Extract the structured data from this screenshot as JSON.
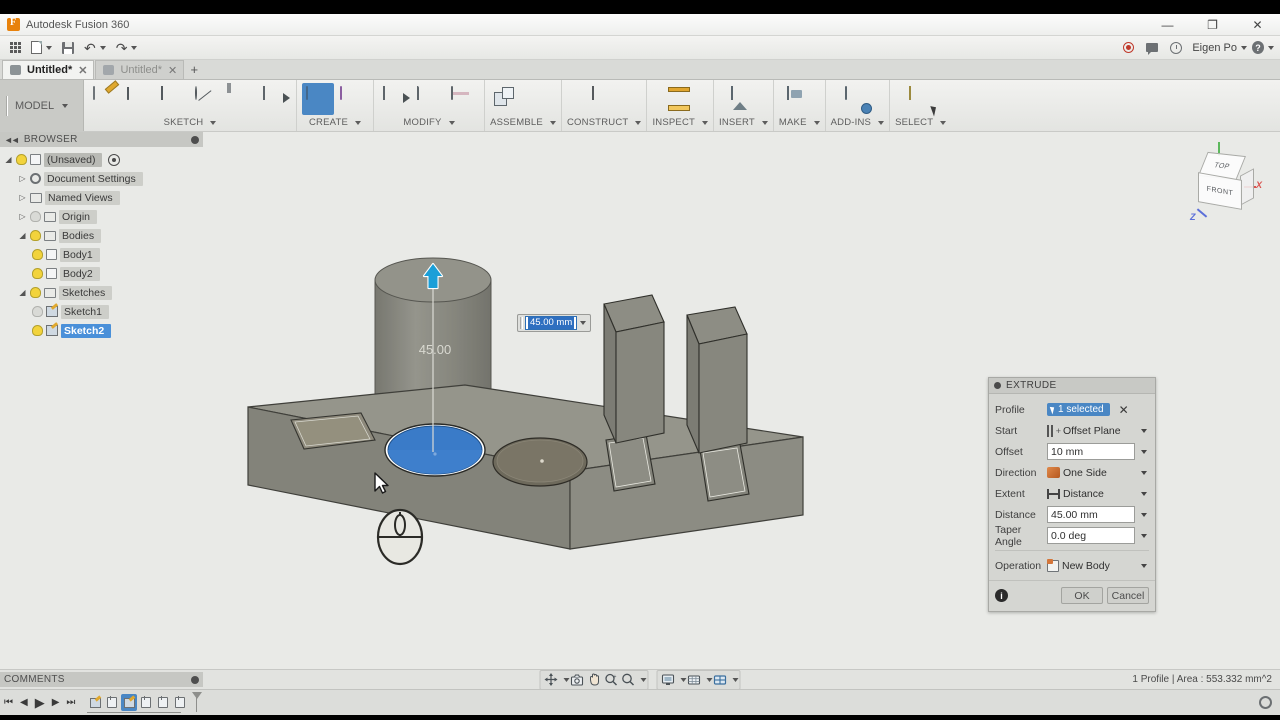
{
  "window": {
    "title": "Autodesk Fusion 360",
    "minimize": "—",
    "maximize": "❐",
    "close": "✕"
  },
  "quick_access": {
    "items": [
      {
        "name": "app-grid",
        "icon": "grid-icon",
        "label": ""
      },
      {
        "name": "file",
        "icon": "document-icon",
        "label": ""
      },
      {
        "name": "save",
        "icon": "save-icon",
        "label": ""
      },
      {
        "name": "undo",
        "icon": "undo-icon",
        "label": "↶"
      },
      {
        "name": "redo",
        "icon": "redo-icon",
        "label": "↷"
      }
    ],
    "right": {
      "record_icon": "record-icon",
      "chat_icon": "chat-icon",
      "clock_icon": "clock-icon",
      "user_name": "Eigen Po",
      "help_icon": "help-icon",
      "help_glyph": "?"
    }
  },
  "tabs": [
    {
      "label": "Untitled*",
      "active": true,
      "close": "✕"
    },
    {
      "label": "Untitled*",
      "active": false,
      "close": "✕"
    }
  ],
  "new_tab_label": "+",
  "ribbon": {
    "workspace": "MODEL",
    "groups": [
      {
        "label": "SKETCH",
        "buttons": [
          {
            "name": "create-sketch-button",
            "icon": "create-sketch-icon"
          },
          {
            "name": "line-button",
            "icon": "line-arc-icon"
          },
          {
            "name": "rectangle-button",
            "icon": "rectangle-icon"
          },
          {
            "name": "circle-button",
            "icon": "circle-icon"
          },
          {
            "name": "dimension-button",
            "icon": "sketch-dimension-icon"
          },
          {
            "name": "sketch-extras-button",
            "icon": "sketch-palette-icon"
          }
        ]
      },
      {
        "label": "CREATE",
        "buttons": [
          {
            "name": "extrude-button",
            "icon": "extrude-icon",
            "selected": true
          },
          {
            "name": "revolve-button",
            "icon": "revolve-icon"
          }
        ]
      },
      {
        "label": "MODIFY",
        "buttons": [
          {
            "name": "press-pull-button",
            "icon": "press-pull-icon"
          },
          {
            "name": "fillet-button",
            "icon": "fillet-icon"
          },
          {
            "name": "shell-button",
            "icon": "shell-icon"
          }
        ]
      },
      {
        "label": "ASSEMBLE",
        "buttons": [
          {
            "name": "new-component-button",
            "icon": "new-component-icon"
          },
          {
            "name": "joint-button",
            "icon": "joint-icon"
          }
        ]
      },
      {
        "label": "CONSTRUCT",
        "buttons": [
          {
            "name": "construct-plane-button",
            "icon": "construction-plane-icon"
          }
        ]
      },
      {
        "label": "INSPECT",
        "buttons": [
          {
            "name": "measure-button",
            "icon": "measure-icon"
          }
        ]
      },
      {
        "label": "INSERT",
        "buttons": [
          {
            "name": "insert-mcmaster-button",
            "icon": "insert-image-icon"
          }
        ]
      },
      {
        "label": "MAKE",
        "buttons": [
          {
            "name": "make-3dprint-button",
            "icon": "make-icon"
          }
        ]
      },
      {
        "label": "ADD-INS",
        "buttons": [
          {
            "name": "scripts-addins-button",
            "icon": "add-ins-icon"
          }
        ]
      },
      {
        "label": "SELECT",
        "buttons": [
          {
            "name": "select-tool-button",
            "icon": "select-icon"
          }
        ]
      }
    ]
  },
  "browser": {
    "title": "BROWSER",
    "collapse_icon": "collapse-left-icon",
    "settings_icon": "panel-settings-icon",
    "nodes": [
      {
        "label": "(Unsaved)",
        "indent": 0,
        "twisty": "open",
        "bulb": true,
        "icon": "component-icon",
        "selected": false,
        "root": true,
        "has_target": true
      },
      {
        "label": "Document Settings",
        "indent": 1,
        "twisty": "closed",
        "bulb": false,
        "icon": "gear-icon",
        "selected": false
      },
      {
        "label": "Named Views",
        "indent": 1,
        "twisty": "closed",
        "bulb": false,
        "icon": "folder-icon",
        "selected": false
      },
      {
        "label": "Origin",
        "indent": 1,
        "twisty": "closed",
        "bulb": true,
        "icon": "folder-icon",
        "selected": false
      },
      {
        "label": "Bodies",
        "indent": 1,
        "twisty": "open",
        "bulb": true,
        "icon": "folder-icon",
        "selected": false
      },
      {
        "label": "Body1",
        "indent": 2,
        "twisty": "none",
        "bulb": true,
        "icon": "body-icon",
        "selected": false
      },
      {
        "label": "Body2",
        "indent": 2,
        "twisty": "none",
        "bulb": true,
        "icon": "body-icon",
        "selected": false
      },
      {
        "label": "Sketches",
        "indent": 1,
        "twisty": "open",
        "bulb": true,
        "icon": "folder-icon",
        "selected": false
      },
      {
        "label": "Sketch1",
        "indent": 2,
        "twisty": "none",
        "bulb": true,
        "icon": "sketch-icon",
        "selected": false
      },
      {
        "label": "Sketch2",
        "indent": 2,
        "twisty": "none",
        "bulb": true,
        "icon": "sketch-icon",
        "selected": true
      }
    ]
  },
  "viewport": {
    "dimension_chip": {
      "value": "45.00 mm",
      "dropdown_icon": "chevron-down-icon"
    },
    "manipulator_arrow": "extrude-arrow-up-icon",
    "onscreen_dimension": "45.00",
    "view_cube": {
      "top_face": "TOP",
      "front_face": "FRONT",
      "x_axis": "X",
      "z_axis": "Z"
    },
    "mouse_overlay_icon": "mouse-icon",
    "cursor_icon": "arrow-cursor-icon"
  },
  "extrude_dialog": {
    "title": "EXTRUDE",
    "rows": [
      {
        "label": "Profile",
        "type": "selection",
        "value": "1 selected",
        "clear": "✕"
      },
      {
        "label": "Start",
        "type": "combo",
        "value": "Offset Plane",
        "icon": "offset-plane-icon"
      },
      {
        "label": "Offset",
        "type": "field",
        "value": "10 mm"
      },
      {
        "label": "Direction",
        "type": "combo",
        "value": "One Side",
        "icon": "direction-icon"
      },
      {
        "label": "Extent",
        "type": "combo",
        "value": "Distance",
        "icon": "extent-distance-icon"
      },
      {
        "label": "Distance",
        "type": "field",
        "value": "45.00 mm"
      },
      {
        "label": "Taper Angle",
        "type": "field",
        "value": "0.0 deg"
      },
      {
        "label": "Operation",
        "type": "combo",
        "value": "New Body",
        "icon": "new-body-icon",
        "separated": true
      }
    ],
    "info_icon": "info-icon",
    "info_glyph": "i",
    "ok_label": "OK",
    "cancel_label": "Cancel"
  },
  "status_bar": {
    "comments_label": "COMMENTS",
    "comments_settings_icon": "panel-settings-icon",
    "text": "1 Profile | Area : 553.332 mm^2",
    "nav_group_1": [
      {
        "name": "orbit-button",
        "icon": "orbit-icon",
        "caret": true
      },
      {
        "name": "look-at-button",
        "icon": "look-at-icon",
        "caret": false
      },
      {
        "name": "pan-button",
        "icon": "pan-hand-icon",
        "caret": false
      },
      {
        "name": "zoom-button",
        "icon": "zoom-icon",
        "caret": false
      },
      {
        "name": "fit-button",
        "icon": "magnifier-icon",
        "caret": true
      }
    ],
    "nav_group_2": [
      {
        "name": "display-settings-button",
        "icon": "display-settings-icon",
        "caret": true
      },
      {
        "name": "grid-snaps-button",
        "icon": "grid-snaps-icon",
        "caret": true
      },
      {
        "name": "viewports-button",
        "icon": "viewports-icon",
        "caret": true
      }
    ]
  },
  "timeline": {
    "controls": [
      {
        "name": "jump-start-button",
        "glyph": "⏮"
      },
      {
        "name": "step-back-button",
        "glyph": "◀"
      },
      {
        "name": "play-button",
        "glyph": "▶"
      },
      {
        "name": "step-forward-button",
        "glyph": "▶"
      },
      {
        "name": "jump-end-button",
        "glyph": "⏭"
      }
    ],
    "features": [
      {
        "name": "timeline-sketch1",
        "icon": "sketch-feature-icon",
        "selected": false
      },
      {
        "name": "timeline-extrude1",
        "icon": "extrude-feature-icon",
        "selected": false
      },
      {
        "name": "timeline-sketch2",
        "icon": "sketch-feature-icon",
        "selected": true
      },
      {
        "name": "timeline-extrude2",
        "icon": "extrude-feature-icon",
        "selected": false
      },
      {
        "name": "timeline-extrude3",
        "icon": "extrude-feature-icon",
        "selected": false
      },
      {
        "name": "timeline-extrude4",
        "icon": "extrude-feature-icon",
        "selected": false
      }
    ],
    "settings_icon": "gear-icon"
  },
  "colors": {
    "selection_blue": "#3a7bc8",
    "accent_blue": "#4a87c4",
    "tree_highlight": "#4a90d9",
    "viewport_bg": "#e9eae7",
    "model_gray": "#8a8a82"
  }
}
